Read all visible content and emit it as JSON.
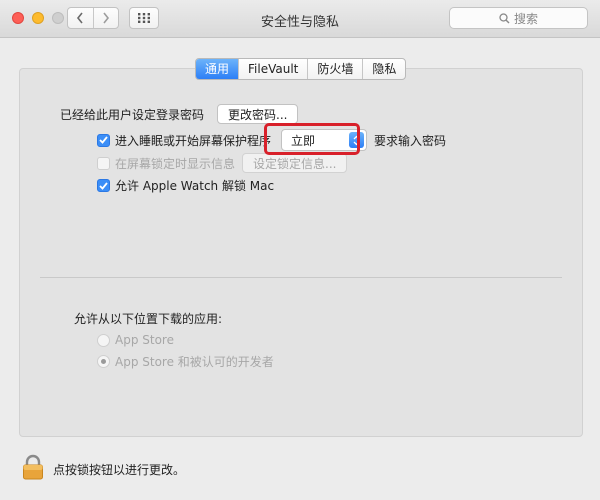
{
  "window": {
    "title": "安全性与隐私"
  },
  "toolbar": {
    "search_placeholder": "搜索"
  },
  "tabs": [
    {
      "label": "通用",
      "active": true
    },
    {
      "label": "FileVault",
      "active": false
    },
    {
      "label": "防火墙",
      "active": false
    },
    {
      "label": "隐私",
      "active": false
    }
  ],
  "general": {
    "password_label": "已经给此用户设定登录密码",
    "change_password_button": "更改密码...",
    "require_password": {
      "checked": true,
      "label_prefix": "进入睡眠或开始屏幕保护程序",
      "delay_value": "立即",
      "label_suffix": "要求输入密码"
    },
    "show_message": {
      "checked": false,
      "enabled": false,
      "label": "在屏幕锁定时显示信息",
      "button": "设定锁定信息..."
    },
    "apple_watch": {
      "checked": true,
      "label": "允许 Apple Watch 解锁 Mac"
    },
    "downloads": {
      "heading": "允许从以下位置下载的应用:",
      "options": [
        {
          "label": "App Store",
          "selected": false
        },
        {
          "label": "App Store 和被认可的开发者",
          "selected": true
        }
      ]
    }
  },
  "footer": {
    "lock_text": "点按锁按钮以进行更改。"
  },
  "colors": {
    "accent": "#2d7ff6",
    "highlight": "#d8202a"
  }
}
